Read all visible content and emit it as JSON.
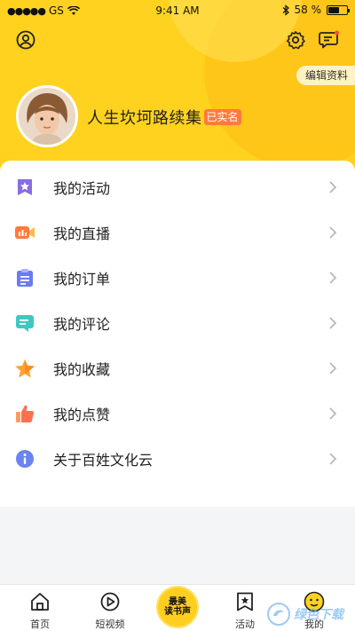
{
  "status_bar": {
    "carrier": "GS",
    "time": "9:41 AM",
    "battery_text": "58 %",
    "battery_level": 0.58
  },
  "header": {
    "edit_profile": "编辑资料",
    "username": "人生坎坷路续集",
    "verified_badge": "已实名",
    "icons": [
      "user-circle-icon",
      "gear-icon",
      "message-icon"
    ],
    "background_color": "#ffd21f"
  },
  "menu": {
    "items": [
      {
        "label": "我的活动",
        "icon": "activity-star-icon",
        "color": "#8a6ddf"
      },
      {
        "label": "我的直播",
        "icon": "live-camera-icon",
        "color": "#ff7a3d"
      },
      {
        "label": "我的订单",
        "icon": "order-clipboard-icon",
        "color": "#6a7cf0"
      },
      {
        "label": "我的评论",
        "icon": "comment-icon",
        "color": "#3ec9c0"
      },
      {
        "label": "我的收藏",
        "icon": "favorite-star-icon",
        "color": "#ffa234"
      },
      {
        "label": "我的点赞",
        "icon": "thumbs-up-icon",
        "color": "#ff7050"
      },
      {
        "label": "关于百姓文化云",
        "icon": "info-icon",
        "color": "#6a84f0"
      }
    ]
  },
  "tabbar": {
    "tabs": [
      {
        "label": "首页",
        "icon": "home-icon"
      },
      {
        "label": "短视频",
        "icon": "play-icon"
      },
      {
        "label": "活动",
        "icon": "bookmark-star-icon"
      },
      {
        "label": "我的",
        "icon": "smiley-icon"
      }
    ],
    "center": {
      "line1": "最美",
      "line2": "读书声"
    }
  },
  "watermark": {
    "text": "绿色下载"
  }
}
